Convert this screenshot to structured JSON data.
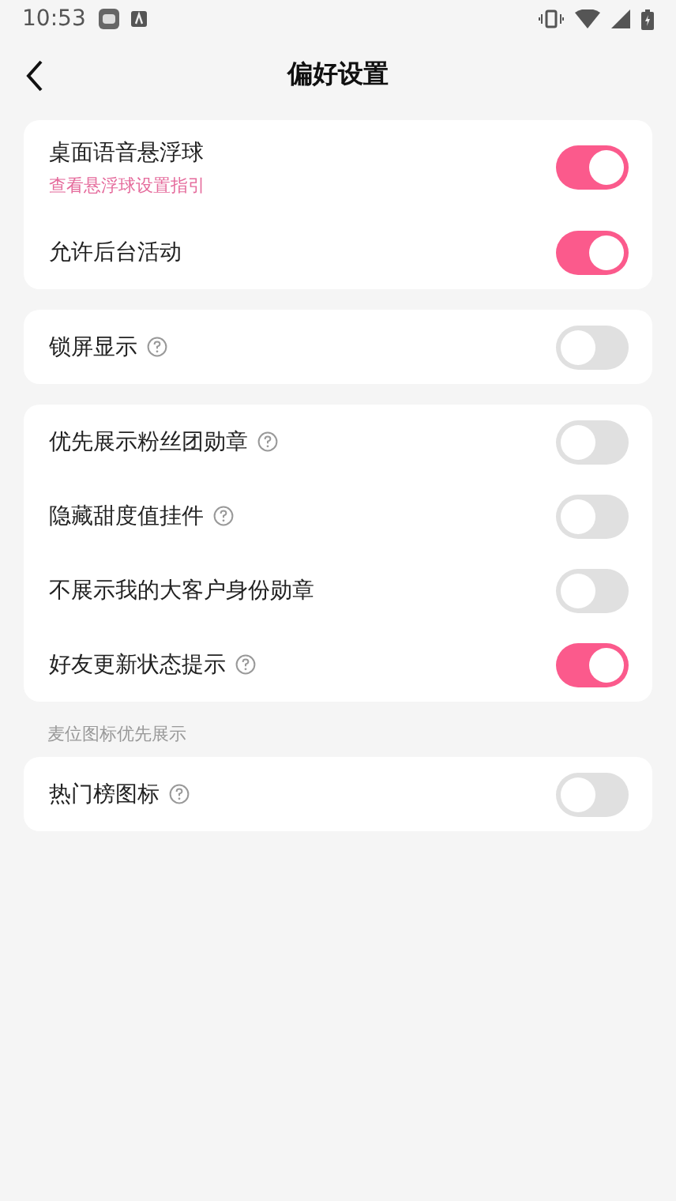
{
  "status_bar": {
    "time": "10:53"
  },
  "header": {
    "title": "偏好设置"
  },
  "groups": [
    {
      "rows": [
        {
          "label": "桌面语音悬浮球",
          "link": "查看悬浮球设置指引",
          "help": false,
          "on": true
        },
        {
          "label": "允许后台活动",
          "help": false,
          "on": true
        }
      ]
    },
    {
      "rows": [
        {
          "label": "锁屏显示",
          "help": true,
          "on": false
        }
      ]
    },
    {
      "rows": [
        {
          "label": "优先展示粉丝团勋章",
          "help": true,
          "on": false
        },
        {
          "label": "隐藏甜度值挂件",
          "help": true,
          "on": false
        },
        {
          "label": "不展示我的大客户身份勋章",
          "help": false,
          "on": false
        },
        {
          "label": "好友更新状态提示",
          "help": true,
          "on": true
        }
      ]
    },
    {
      "caption": "麦位图标优先展示",
      "rows": [
        {
          "label": "热门榜图标",
          "help": true,
          "on": false
        }
      ]
    }
  ]
}
